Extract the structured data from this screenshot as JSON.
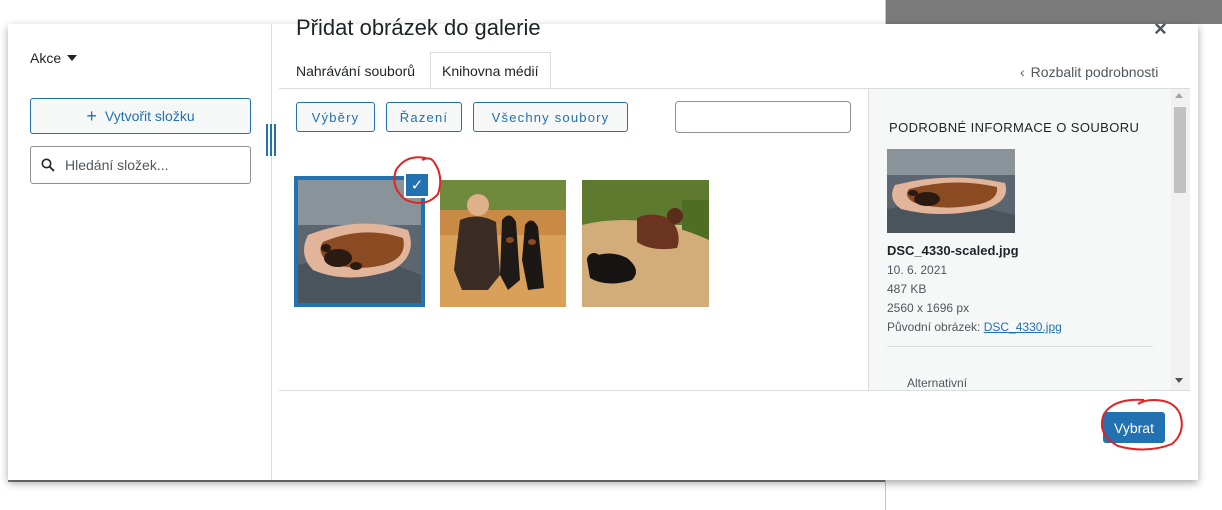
{
  "sidebar": {
    "actions_label": "Akce",
    "create_folder_label": "Vytvořit složku",
    "folder_search_placeholder": "Hledání složek..."
  },
  "dialog": {
    "title": "Přidat obrázek do galerie",
    "close_symbol": "×",
    "tabs": [
      {
        "label": "Nahrávání souborů"
      },
      {
        "label": "Knihovna médií"
      }
    ],
    "active_tab": "Knihovna médií",
    "expand_details_label": "Rozbalit podrobnosti",
    "expand_details_icon": "chevron-left-icon"
  },
  "toolbar": {
    "selections_label": "Výběry",
    "sort_label": "Řazení",
    "all_files_label": "Všechny soubory",
    "search_value": ""
  },
  "media": {
    "items": [
      {
        "subject": "dog paw in human hand",
        "selected": true
      },
      {
        "subject": "man kneeling with two dobermans in field",
        "selected": false
      },
      {
        "subject": "two dobermans lying on wooden deck",
        "selected": false
      }
    ],
    "checkmark": "✓"
  },
  "details": {
    "heading": "PODROBNÉ INFORMACE O SOUBORU",
    "filename": "DSC_4330-scaled.jpg",
    "date": "10. 6. 2021",
    "size": "487 KB",
    "dimensions": "2560 x 1696 px",
    "original_label": "Původní obrázek:",
    "original_link": "DSC_4330.jpg",
    "alt_label": "Alternativní"
  },
  "footer": {
    "select_label": "Vybrat"
  },
  "colors": {
    "accent": "#2271b1",
    "annotation": "#e02424",
    "overlay": "#7f7f7f"
  }
}
